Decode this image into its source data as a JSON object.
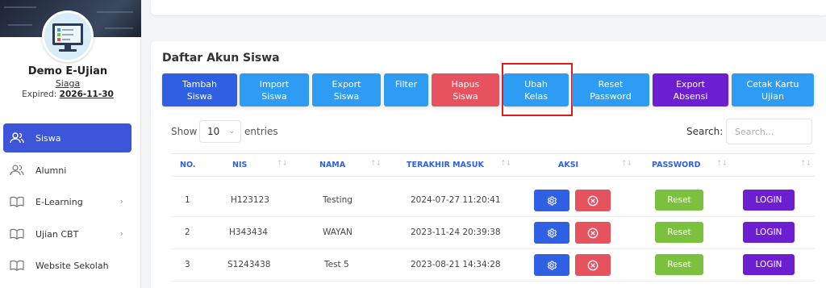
{
  "sidebar": {
    "user": {
      "name": "Demo E-Ujian",
      "role": "Siaga",
      "expired_label": "Expired:",
      "expired_date": "2026-11-30"
    },
    "items": [
      {
        "label": "Siswa",
        "icon": "users-icon",
        "active": true
      },
      {
        "label": "Alumni",
        "icon": "users-icon"
      },
      {
        "label": "E-Learning",
        "icon": "book-icon",
        "has_submenu": true
      },
      {
        "label": "Ujian CBT",
        "icon": "book-icon",
        "has_submenu": true
      },
      {
        "label": "Website Sekolah",
        "icon": "book-icon"
      }
    ]
  },
  "main": {
    "title": "Daftar Akun Siswa",
    "toolbar": {
      "tambah_line1": "Tambah",
      "tambah_line2": "Siswa",
      "import_line1": "Import",
      "import_line2": "Siswa",
      "export_line1": "Export",
      "export_line2": "Siswa",
      "filter": "Filter",
      "hapus_line1": "Hapus",
      "hapus_line2": "Siswa",
      "ubah_line1": "Ubah",
      "ubah_line2": "Kelas",
      "reset_line1": "Reset",
      "reset_line2": "Password",
      "absensi_line1": "Export",
      "absensi_line2": "Absensi",
      "cetak_line1": "Cetak Kartu",
      "cetak_line2": "Ujian"
    },
    "length_menu": {
      "show_label": "Show",
      "value": "10",
      "entries_label": "entries"
    },
    "search": {
      "label": "Search:",
      "placeholder": "Search..."
    },
    "table": {
      "columns": [
        "NO.",
        "NIS",
        "NAMA",
        "TERAKHIR MASUK",
        "AKSI",
        "PASSWORD"
      ],
      "rows": [
        {
          "no": "1",
          "nis": "H123123",
          "nama": "Testing",
          "terakhir_masuk": "2024-07-27 11:20:41",
          "reset": "Reset",
          "login": "LOGIN"
        },
        {
          "no": "2",
          "nis": "H343434",
          "nama": "WAYAN",
          "terakhir_masuk": "2023-11-24 20:39:38",
          "reset": "Reset",
          "login": "LOGIN"
        },
        {
          "no": "3",
          "nis": "S1243438",
          "nama": "Test 5",
          "terakhir_masuk": "2023-08-21 14:34:28",
          "reset": "Reset",
          "login": "LOGIN"
        }
      ]
    }
  },
  "colors": {
    "primary": "#2f5fe3",
    "info": "#2f9cf4",
    "danger": "#e7525f",
    "success": "#7cc13e",
    "purple": "#6c1fd0",
    "highlight": "#e11b1b"
  }
}
